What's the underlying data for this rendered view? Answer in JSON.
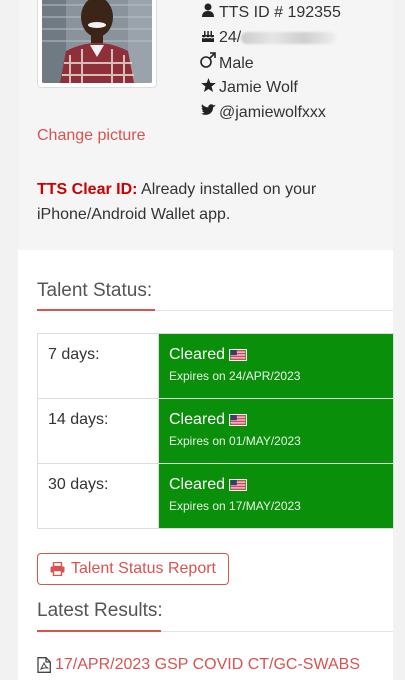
{
  "profile": {
    "tts_id": "TTS ID # 192355",
    "birthday_prefix": "24/",
    "gender": "Male",
    "name": "Jamie Wolf",
    "twitter": "@jamiewolfxxx",
    "change_picture": "Change picture"
  },
  "clear_id": {
    "label": "TTS Clear ID:",
    "text": " Already installed on your iPhone/Android Wallet app."
  },
  "talent_status": {
    "title": "Talent Status:",
    "rows": [
      {
        "days": "7 days:",
        "status": "Cleared",
        "expires": "Expires on 24/APR/2023"
      },
      {
        "days": "14 days:",
        "status": "Cleared",
        "expires": "Expires on 01/MAY/2023"
      },
      {
        "days": "30 days:",
        "status": "Cleared",
        "expires": "Expires on 17/MAY/2023"
      }
    ],
    "cleared_color": "#0a8f0a"
  },
  "report_button": {
    "label": "Talent Status Report"
  },
  "latest_results": {
    "title": "Latest Results:",
    "items": [
      {
        "label": "17/APR/2023 GSP COVID CT/GC-SWABS"
      }
    ]
  },
  "colors": {
    "accent": "#d9534f",
    "alert_label": "#cc0000"
  }
}
